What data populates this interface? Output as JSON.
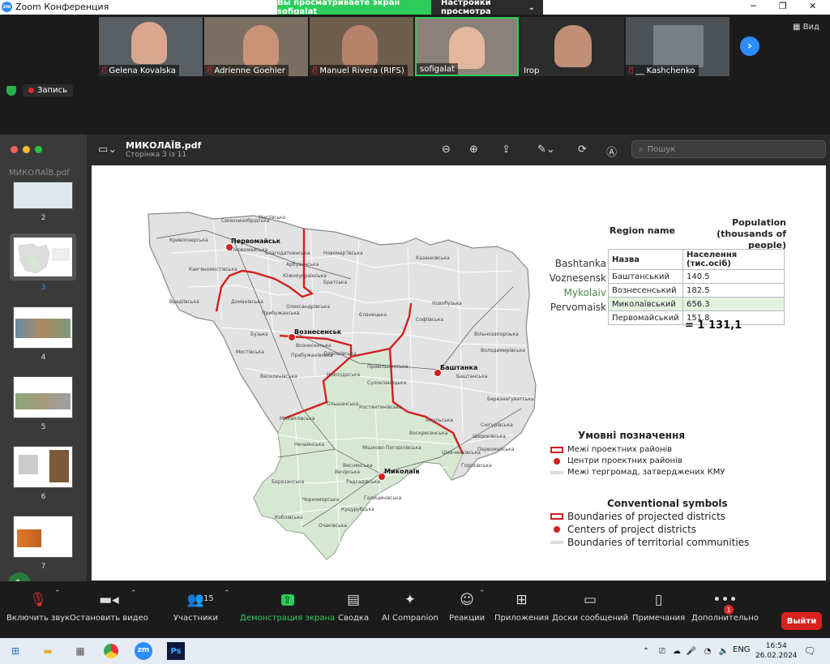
{
  "window": {
    "title": "Zoom Конференция",
    "logo_text": "zm"
  },
  "share_banner": {
    "viewing_text": "Вы просматриваете экран sofigalat",
    "options_label": "Настройки просмотра"
  },
  "participants": [
    {
      "name": "Gelena Kovalska",
      "muted": true
    },
    {
      "name": "Adrienne Goehler",
      "muted": true
    },
    {
      "name": "Manuel Rivera (RIFS)",
      "muted": true
    },
    {
      "name": "sofigalat",
      "muted": false
    },
    {
      "name": "Irop",
      "muted": false
    },
    {
      "name": "__ Kashchenko",
      "muted": true
    }
  ],
  "view_button": "Вид",
  "recording_label": "Запись",
  "pdf": {
    "file_name": "МИКОЛАЇВ.pdf",
    "page_info": "Сторінка 3 із 11",
    "search_placeholder": "Пошук",
    "sidebar_title": "МИКОЛАЇВ.pdf",
    "thumbnails": [
      "2",
      "3",
      "4",
      "5",
      "6",
      "7"
    ],
    "selected_page": "3"
  },
  "slide": {
    "table_header_left": "Region name",
    "table_header_right": "Population (thousands of people)",
    "col_name": "Назва",
    "col_pop": "Населення (тис.осіб)",
    "rows": [
      {
        "en": "Bashtanka",
        "ua": "Баштанський",
        "pop": "140.5"
      },
      {
        "en": "Voznesensk",
        "ua": "Вознесенський",
        "pop": "182.5"
      },
      {
        "en": "Mykolaiv",
        "ua": "Миколаївський",
        "pop": "656.3"
      },
      {
        "en": "Pervomaisk",
        "ua": "Первомайський",
        "pop": "151.8"
      }
    ],
    "total": "= 1 131,1",
    "legend_ua_title": "Умовні позначення",
    "legend_ua": [
      "Межі проектних районів",
      "Центри проектних районів",
      "Межі тергромад, затверджених КМУ"
    ],
    "legend_en_title": "Conventional symbols",
    "legend_en": [
      "Boundaries of projected districts",
      "Centers of project districts",
      "Boundaries of territorial communities"
    ],
    "cities": [
      "Первомайськ",
      "Вознесенськ",
      "Баштанка",
      "Миколаїв"
    ],
    "map_labels": [
      "Синюхинобрідська",
      "Мигіївська",
      "Кривоозерська",
      "Первомайська",
      "Благодатненська",
      "Новомарʼївська",
      "Врадіївська",
      "Кам'яномостівська",
      "Арбузинська",
      "Южноукраїнська",
      "Братська",
      "Казанківська",
      "Доманівська",
      "Прибужанська",
      "Олександрівська",
      "Єланецька",
      "Новобузька",
      "Мостівська",
      "Вознесенська",
      "Бузька",
      "Софіївська",
      "Веселинівська",
      "Прибужанівська",
      "Дорошівська",
      "Привільненська",
      "Новоодеська",
      "Баштанська",
      "Володимирівська",
      "Березнегуватська",
      "Снігурівська",
      "Інгульська",
      "Михайлівська",
      "Костянтинівська",
      "Ольшанська",
      "Сухоєланецька",
      "Нечаянська",
      "Мішково-Погорілівська",
      "Воскресенська",
      "Широківська",
      "Вечірська",
      "Березанська",
      "Галицинівська",
      "Куцурубська",
      "Очаківська",
      "Коблівська",
      "Чорноморська",
      "Радсадівська",
      "Шевченківська",
      "Горохівська",
      "Первомайська",
      "Веснянська",
      "Вільнозапорізька"
    ]
  },
  "controls": [
    {
      "label": "Включить звук",
      "icon": "mic-off-icon"
    },
    {
      "label": "Остановить видео",
      "icon": "video-icon"
    },
    {
      "label": "Участники",
      "icon": "participants-icon"
    },
    {
      "label": "Демонстрация экрана",
      "icon": "share-screen-icon"
    },
    {
      "label": "Сводка",
      "icon": "summary-icon"
    },
    {
      "label": "AI Companion",
      "icon": "ai-companion-icon"
    },
    {
      "label": "Реакции",
      "icon": "reactions-icon"
    },
    {
      "label": "Приложения",
      "icon": "apps-icon"
    },
    {
      "label": "Доски сообщений",
      "icon": "whiteboard-icon"
    },
    {
      "label": "Примечания",
      "icon": "notes-icon"
    },
    {
      "label": "Дополнительно",
      "icon": "more-icon"
    }
  ],
  "participants_count": "15",
  "more_badge": "1",
  "leave_label": "Выйти",
  "taskbar": {
    "lang": "ENG",
    "time": "16:54",
    "date": "26.02.2024",
    "ps_label": "Ps"
  },
  "colors": {
    "zoom_blue": "#2d8cff",
    "share_green": "#2ecc5c",
    "leave_red": "#d92020",
    "boundary_red": "#d32020",
    "district_fill": "#e2e2e2",
    "mykolaiv_fill": "#d7e8d2"
  }
}
